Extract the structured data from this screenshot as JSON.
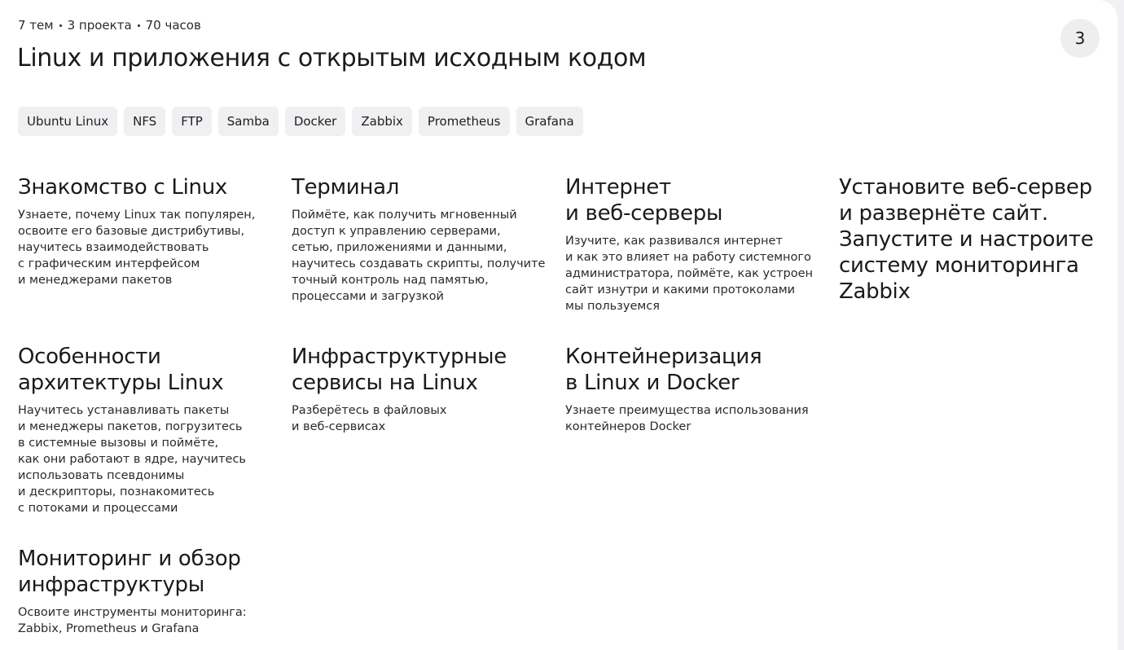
{
  "header": {
    "meta": [
      "7 тем",
      "3 проекта",
      "70 часов"
    ],
    "title": "Linux и приложения с открытым исходным кодом",
    "badge": "3"
  },
  "tags": [
    "Ubuntu Linux",
    "NFS",
    "FTP",
    "Samba",
    "Docker",
    "Zabbix",
    "Prometheus",
    "Grafana"
  ],
  "topics": [
    {
      "title": "Знакомство с Linux",
      "description": "Узнаете, почему Linux так популярен,\nосвоите его базовые дистрибутивы,\nнаучитесь взаимодействовать\nс графическим интерфейсом\nи менеджерами пакетов"
    },
    {
      "title": "Терминал",
      "description": "Поймёте, как получить мгновенный\nдоступ к управлению серверами,\nсетью, приложениями и данными,\nнаучитесь создавать скрипты, получите\nточный контроль над памятью,\nпроцессами и загрузкой"
    },
    {
      "title": "Интернет\nи веб-серверы",
      "description": "Изучите, как развивался интернет\nи как это влияет на работу системного\nадминистратора, поймёте, как устроен\nсайт изнутри и какими протоколами\nмы пользуемся"
    },
    {
      "title": "Установите веб-сервер\nи развернёте сайт.\nЗапустите и настроите\nсистему мониторинга\nZabbix",
      "description": ""
    },
    {
      "title": "Особенности\nархитектуры Linux",
      "description": "Научитесь устанавливать пакеты\nи менеджеры пакетов, погрузитесь\nв системные вызовы и поймёте,\nкак они работают в ядре, научитесь\nиспользовать псевдонимы\nи дескрипторы, познакомитесь\nс потоками и процессами"
    },
    {
      "title": "Инфраструктурные\nсервисы на Linux",
      "description": "Разберётесь в файловых\nи веб-сервисах"
    },
    {
      "title": "Контейнеризация\nв Linux и Docker",
      "description": "Узнаете преимущества использования\nконтейнеров Docker"
    },
    {
      "title": "Мониторинг и обзор\nинфраструктуры",
      "description": "Освоите инструменты мониторинга:\nZabbix, Prometheus и Grafana"
    }
  ]
}
